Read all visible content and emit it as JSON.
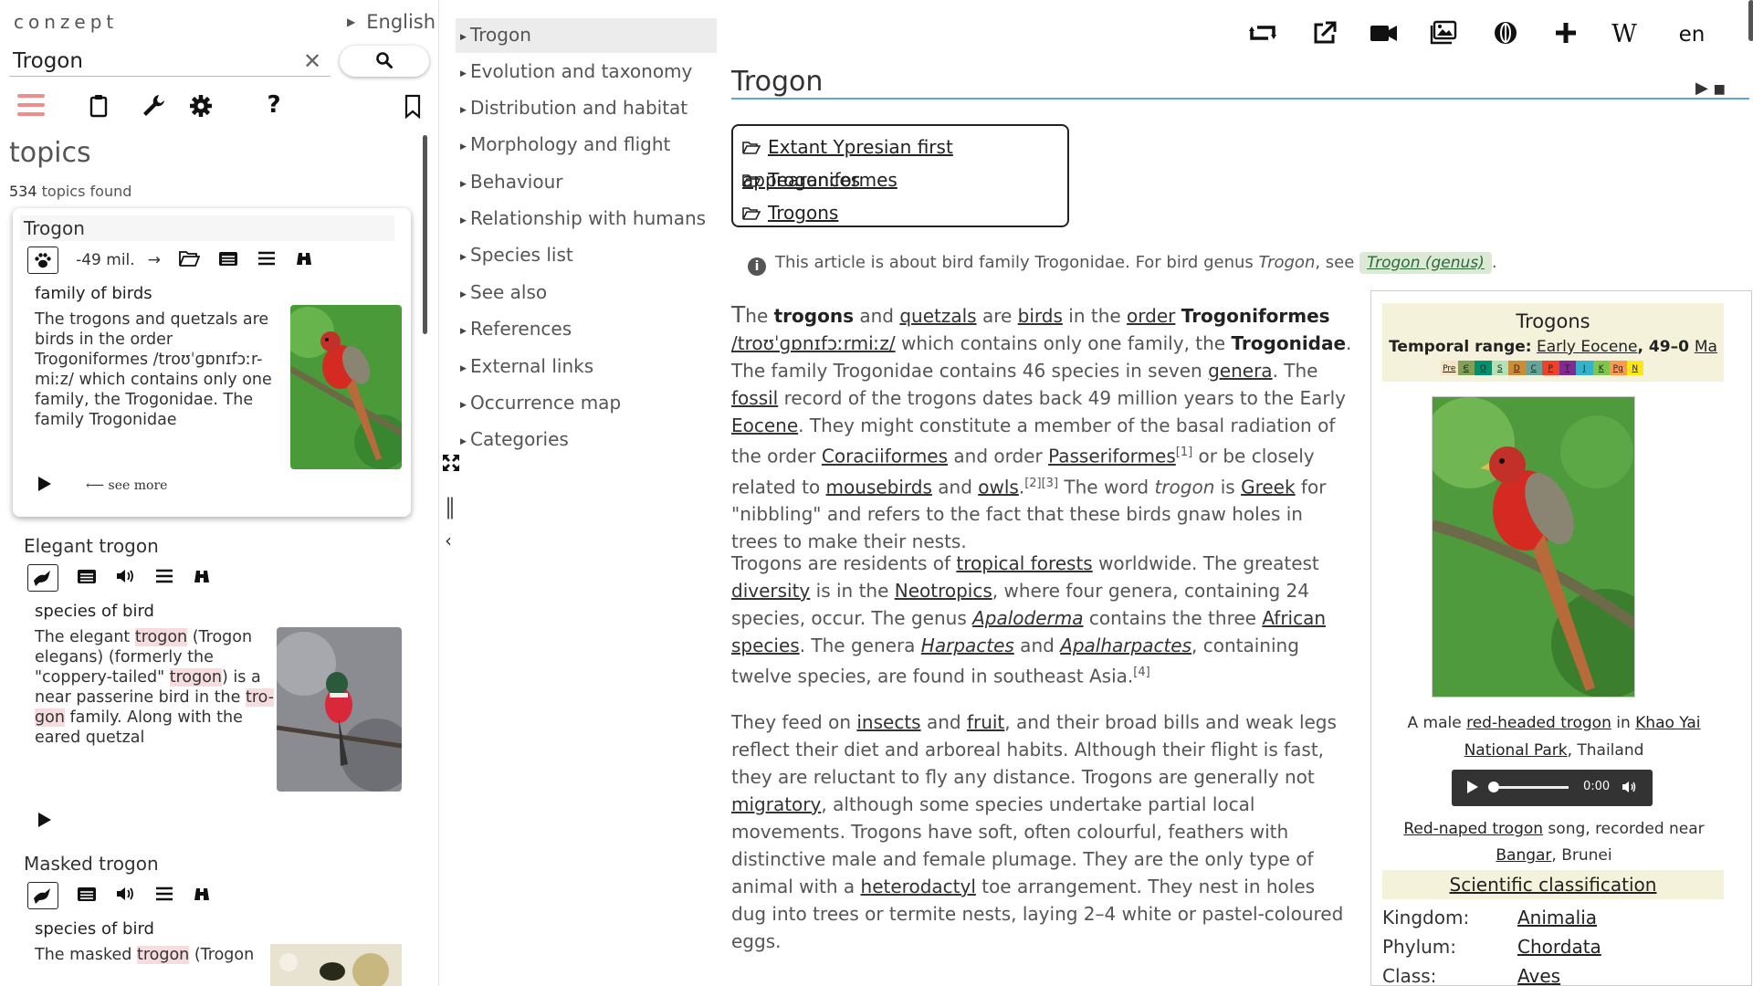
{
  "app": {
    "brand": "conzept",
    "language": "English"
  },
  "search": {
    "value": "Trogon",
    "clear_icon": "close-icon",
    "button_icon": "search-icon"
  },
  "toolbar": {
    "icons": [
      "hamburger-menu-icon",
      "clipboard-icon",
      "wrench-icon",
      "gear-icon",
      "help-icon",
      "bookmark-icon"
    ]
  },
  "topics": {
    "heading": "topics",
    "count": "534",
    "count_suffix": "topics found"
  },
  "results": [
    {
      "title": "Trogon",
      "time": "-49 mil.",
      "type": "family of birds",
      "desc": "The trogons and quetzals are birds in the order Trogoniformes /troʊˈɡɒnɪfɔːr-miːz/ which contains only one family, the Trogonidae. The family Trogonidae",
      "see_more": "see more"
    },
    {
      "title": "Elegant trogon",
      "type": "species of bird",
      "desc_parts": [
        "The elegant ",
        "trogon",
        " (Trogon elegans) (formerly the \"coppery-tailed\" ",
        "trogon",
        ") is a near passerine bird in the ",
        "tro-gon",
        " family. Along with the eared quetzal"
      ]
    },
    {
      "title": "Masked trogon",
      "type": "species of bird",
      "desc_parts": [
        "The masked ",
        "trogon",
        " (Trogon"
      ]
    }
  ],
  "toc": {
    "items": [
      "Trogon",
      "Evolution and taxonomy",
      "Distribution and habitat",
      "Morphology and flight",
      "Behaviour",
      "Relationship with humans",
      "Species list",
      "See also",
      "References",
      "External links",
      "Occurrence map",
      "Categories"
    ],
    "active_index": 0
  },
  "topbar": {
    "icons": [
      "retweet-icon",
      "external-link-icon",
      "video-camera-icon",
      "image-gallery-icon",
      "globe-circle-icon",
      "plus-icon",
      "wikipedia-icon"
    ],
    "wiki_label": "W",
    "lang": "en"
  },
  "article": {
    "title": "Trogon",
    "categories": [
      "Extant Ypresian first appearances",
      "Trogoniformes",
      "Trogons"
    ],
    "hatnote": {
      "text": "This article is about bird family Trogonidae. For bird genus ",
      "genus_italic": "Trogon",
      "see": ", see ",
      "link": "Trogon (genus)",
      "end": "."
    },
    "p1": {
      "first_letter": "T",
      "text_parts": [
        "he ",
        "trogons",
        " and ",
        "quetzals",
        " are ",
        "birds",
        " in the ",
        "order",
        " ",
        "Trogoniformes",
        " ",
        "/troʊˈɡɒnɪfɔːrmiːz/",
        " which contains only one family, the ",
        "Trogonidae",
        ". The family Trogonidae contains 46 species in seven ",
        "genera",
        ". The ",
        "fossil",
        " record of the trogons dates back 49 million years to the Early ",
        "Eocene",
        ". They might constitute a member of the basal radiation of the order ",
        "Coraciiformes",
        " and order ",
        "Passeriformes",
        "[1]",
        " or be closely related to ",
        "mousebirds",
        " and ",
        "owls",
        ".",
        "[2][3]",
        " The word ",
        "trogon",
        " is ",
        "Greek",
        " for \"nibbling\" and refers to the fact that these birds gnaw holes in trees to make their nests."
      ]
    },
    "p2": {
      "text_parts": [
        "Trogons are residents of ",
        "tropical forests",
        " worldwide. The greatest ",
        "diversity",
        " is in the ",
        "Neotropics",
        ", where four genera, containing 24 species, occur. The genus ",
        "Apaloderma",
        " contains the three ",
        "African",
        " ",
        "species",
        ". The genera ",
        "Harpactes",
        " and ",
        "Apalharpactes",
        ", containing twelve species, are found in southeast Asia.",
        "[4]"
      ]
    },
    "p3": {
      "text_parts": [
        "They feed on ",
        "insects",
        " and ",
        "fruit",
        ", and their broad bills and weak legs reflect their diet and arboreal habits. Although their flight is fast, they are reluctant to fly any distance. Trogons are generally not ",
        "migratory",
        ", although some species undertake partial local movements. Trogons have soft, often colourful, feathers with distinctive male and female plumage. They are the only type of animal with a ",
        "heterodactyl",
        " toe arrangement. They nest in holes dug into trees or termite nests, laying 2–4 white or pastel-coloured eggs."
      ]
    }
  },
  "infobox": {
    "name": "Trogons",
    "range_label": "Temporal range:",
    "range_link": "Early Eocene",
    "range_value": ", 49–0 ",
    "range_unit": "Ma",
    "timeline_labels": [
      "Pre",
      "Є",
      "O",
      "S",
      "D",
      "C",
      "P",
      "T",
      "J",
      "K",
      "Pg",
      "N"
    ],
    "timeline_colors": [
      "#f4e4c6",
      "#7fa056",
      "#009270",
      "#b3e1b6",
      "#cb8c37",
      "#67a599",
      "#f04028",
      "#812b92",
      "#34b2c9",
      "#7fc64e",
      "#fd9a52",
      "#ffe619"
    ],
    "caption_parts": [
      "A male ",
      "red-headed trogon",
      " in ",
      "Khao Yai National Park",
      ", Thailand"
    ],
    "audio_time": "0:00",
    "audio_caption_parts": [
      "Red-naped trogon",
      " song, recorded near ",
      "Bangar",
      ", Brunei"
    ],
    "sci_heading": "Scientific classification",
    "classification": [
      {
        "rank": "Kingdom:",
        "value": "Animalia"
      },
      {
        "rank": "Phylum:",
        "value": "Chordata"
      },
      {
        "rank": "Class:",
        "value": "Aves"
      }
    ]
  }
}
